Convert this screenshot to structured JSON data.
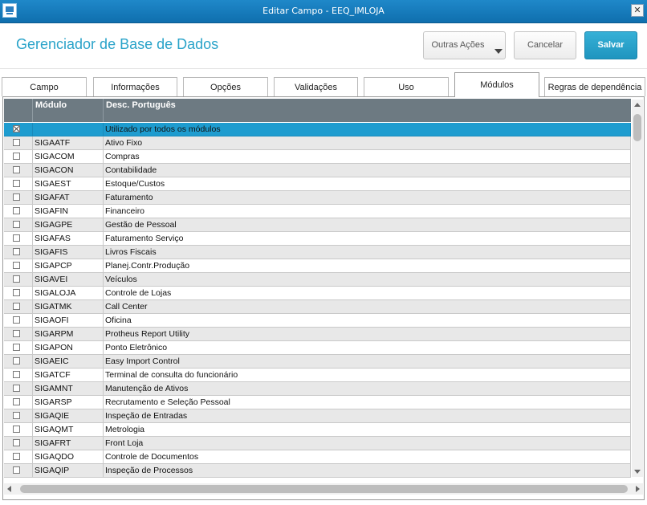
{
  "window": {
    "title": "Editar Campo - EEQ_IMLOJA",
    "close_label": "✕"
  },
  "header": {
    "title": "Gerenciador de Base de Dados",
    "actions": {
      "outras_label": "Outras Ações",
      "cancelar_label": "Cancelar",
      "salvar_label": "Salvar"
    }
  },
  "colors": {
    "accent": "#1e9ccf",
    "title": "#29a3c9",
    "header_bg": "#6d7a82"
  },
  "tabs": [
    {
      "label": "Campo"
    },
    {
      "label": "Informações"
    },
    {
      "label": "Opções"
    },
    {
      "label": "Validações"
    },
    {
      "label": "Uso"
    },
    {
      "label": "Módulos"
    },
    {
      "label": "Regras de dependência"
    }
  ],
  "active_tab": "Módulos",
  "grid": {
    "columns": [
      "",
      "Módulo",
      "Desc. Português"
    ],
    "rows": [
      {
        "checked": true,
        "module": "",
        "desc": "Utilizado por todos os módulos",
        "selected": true
      },
      {
        "checked": false,
        "module": "SIGAATF",
        "desc": "Ativo Fixo"
      },
      {
        "checked": false,
        "module": "SIGACOM",
        "desc": "Compras"
      },
      {
        "checked": false,
        "module": "SIGACON",
        "desc": "Contabilidade"
      },
      {
        "checked": false,
        "module": "SIGAEST",
        "desc": "Estoque/Custos"
      },
      {
        "checked": false,
        "module": "SIGAFAT",
        "desc": "Faturamento"
      },
      {
        "checked": false,
        "module": "SIGAFIN",
        "desc": "Financeiro"
      },
      {
        "checked": false,
        "module": "SIGAGPE",
        "desc": "Gestão de Pessoal"
      },
      {
        "checked": false,
        "module": "SIGAFAS",
        "desc": "Faturamento Serviço"
      },
      {
        "checked": false,
        "module": "SIGAFIS",
        "desc": "Livros Fiscais"
      },
      {
        "checked": false,
        "module": "SIGAPCP",
        "desc": "Planej.Contr.Produção"
      },
      {
        "checked": false,
        "module": "SIGAVEI",
        "desc": "Veículos"
      },
      {
        "checked": false,
        "module": "SIGALOJA",
        "desc": "Controle de Lojas"
      },
      {
        "checked": false,
        "module": "SIGATMK",
        "desc": "Call Center"
      },
      {
        "checked": false,
        "module": "SIGAOFI",
        "desc": "Oficina"
      },
      {
        "checked": false,
        "module": "SIGARPM",
        "desc": "Protheus Report Utility"
      },
      {
        "checked": false,
        "module": "SIGAPON",
        "desc": "Ponto Eletrônico"
      },
      {
        "checked": false,
        "module": "SIGAEIC",
        "desc": "Easy Import Control"
      },
      {
        "checked": false,
        "module": "SIGATCF",
        "desc": "Terminal de consulta do funcionário"
      },
      {
        "checked": false,
        "module": "SIGAMNT",
        "desc": "Manutenção de Ativos"
      },
      {
        "checked": false,
        "module": "SIGARSP",
        "desc": "Recrutamento e Seleção Pessoal"
      },
      {
        "checked": false,
        "module": "SIGAQIE",
        "desc": "Inspeção de Entradas"
      },
      {
        "checked": false,
        "module": "SIGAQMT",
        "desc": "Metrologia"
      },
      {
        "checked": false,
        "module": "SIGAFRT",
        "desc": "Front Loja"
      },
      {
        "checked": false,
        "module": "SIGAQDO",
        "desc": "Controle de Documentos"
      },
      {
        "checked": false,
        "module": "SIGAQIP",
        "desc": "Inspeção de Processos"
      }
    ]
  }
}
